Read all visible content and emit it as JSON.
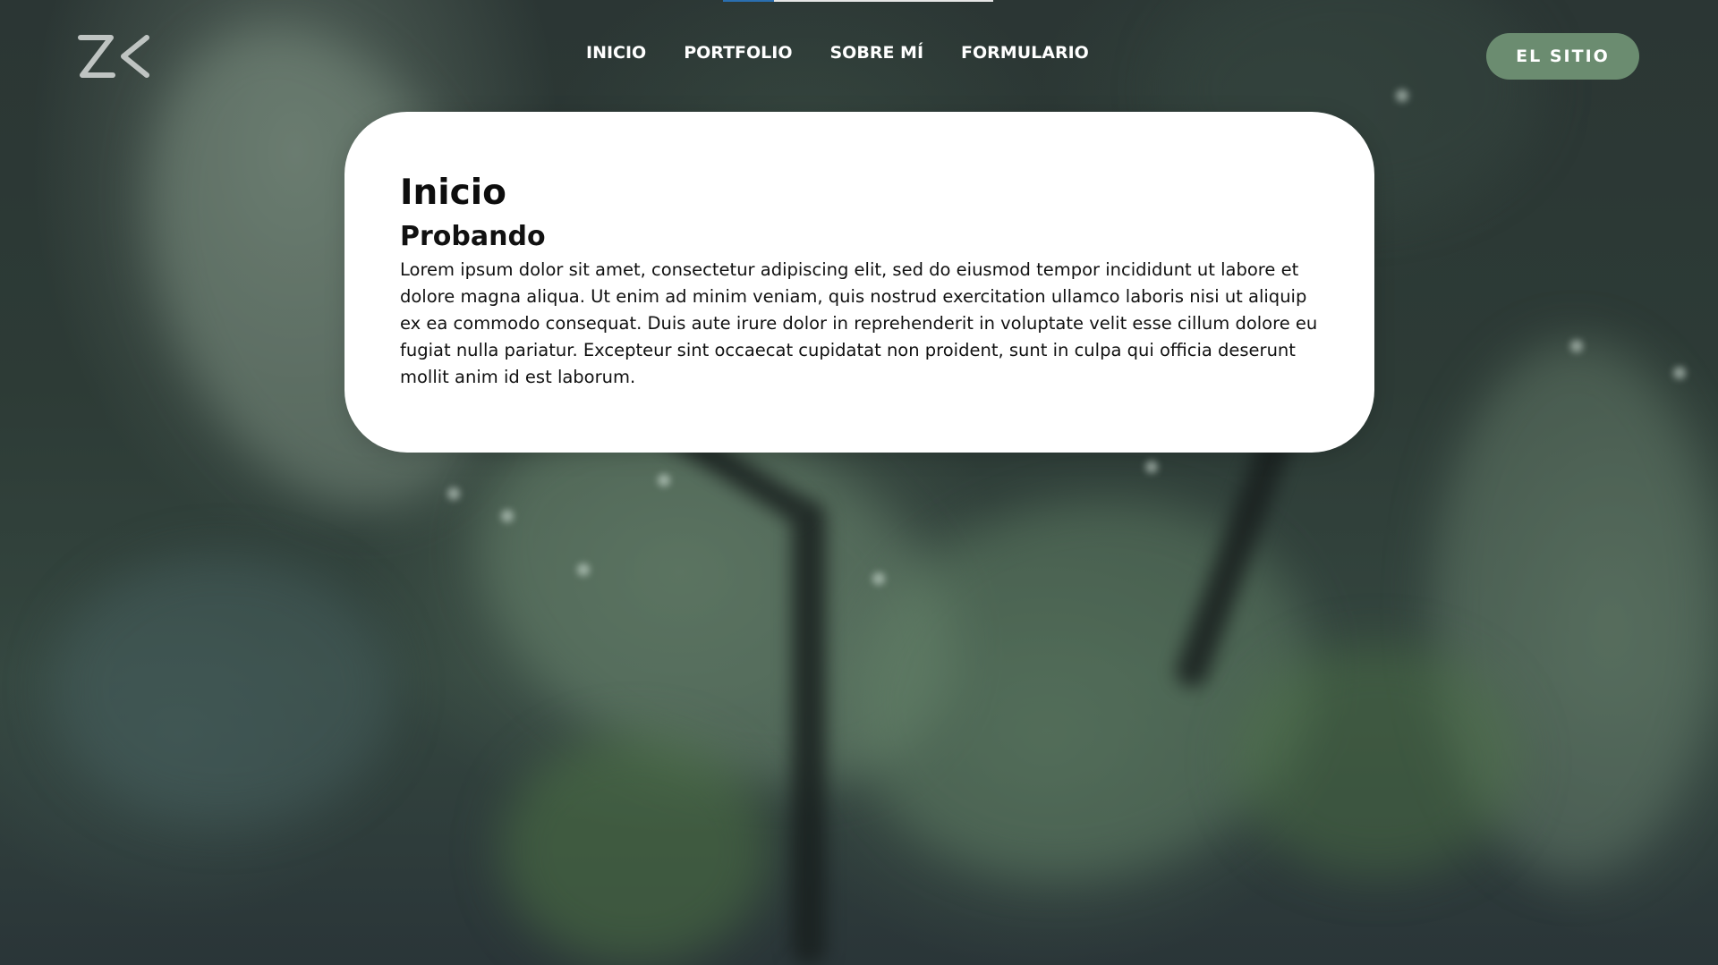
{
  "page": {
    "progress_fraction": 0.19
  },
  "header": {
    "logo": {
      "text": "ZK",
      "icon": "zk-logo-icon"
    },
    "nav": [
      {
        "label": "INICIO"
      },
      {
        "label": "PORTFOLIO"
      },
      {
        "label": "SOBRE MÍ"
      },
      {
        "label": "FORMULARIO"
      }
    ],
    "cta_label": "EL SITIO"
  },
  "main": {
    "title": "Inicio",
    "subtitle": "Probando",
    "body": "Lorem ipsum dolor sit amet, consectetur adipiscing elit, sed do eiusmod tempor incididunt ut labore et dolore magna aliqua. Ut enim ad minim veniam, quis nostrud exercitation ullamco laboris nisi ut aliquip ex ea commodo consequat. Duis aute irure dolor in reprehenderit in voluptate velit esse cillum dolore eu fugiat nulla pariatur. Excepteur sint occaecat cupidatat non proident, sunt in culpa qui officia deserunt mollit anim id est laborum."
  },
  "colors": {
    "accent": "#6b8c70",
    "progress": "#2a6fb0",
    "card_bg": "#ffffff",
    "nav_text": "#ffffff"
  }
}
